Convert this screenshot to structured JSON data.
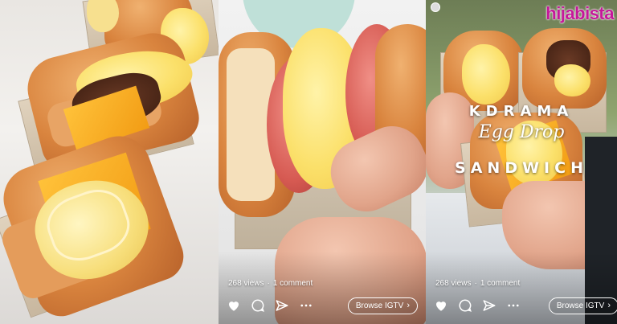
{
  "brand": {
    "logo_text": "hijabista",
    "logo_color": "#c5189a"
  },
  "panels": [
    {
      "views": "",
      "comments": ""
    },
    {
      "views": "268 views",
      "comments": "1 comment",
      "browse_label": "Browse IGTV"
    },
    {
      "views": "268 views",
      "comments": "1 comment",
      "browse_label": "Browse IGTV",
      "title_line1": "KDRAMA",
      "title_line2": "Egg Drop",
      "title_line3": "SANDWICH"
    }
  ],
  "icons": {
    "like": "heart-icon",
    "comment": "comment-icon",
    "share": "send-icon",
    "more": "more-icon",
    "chevron": "chevron-right-icon"
  }
}
